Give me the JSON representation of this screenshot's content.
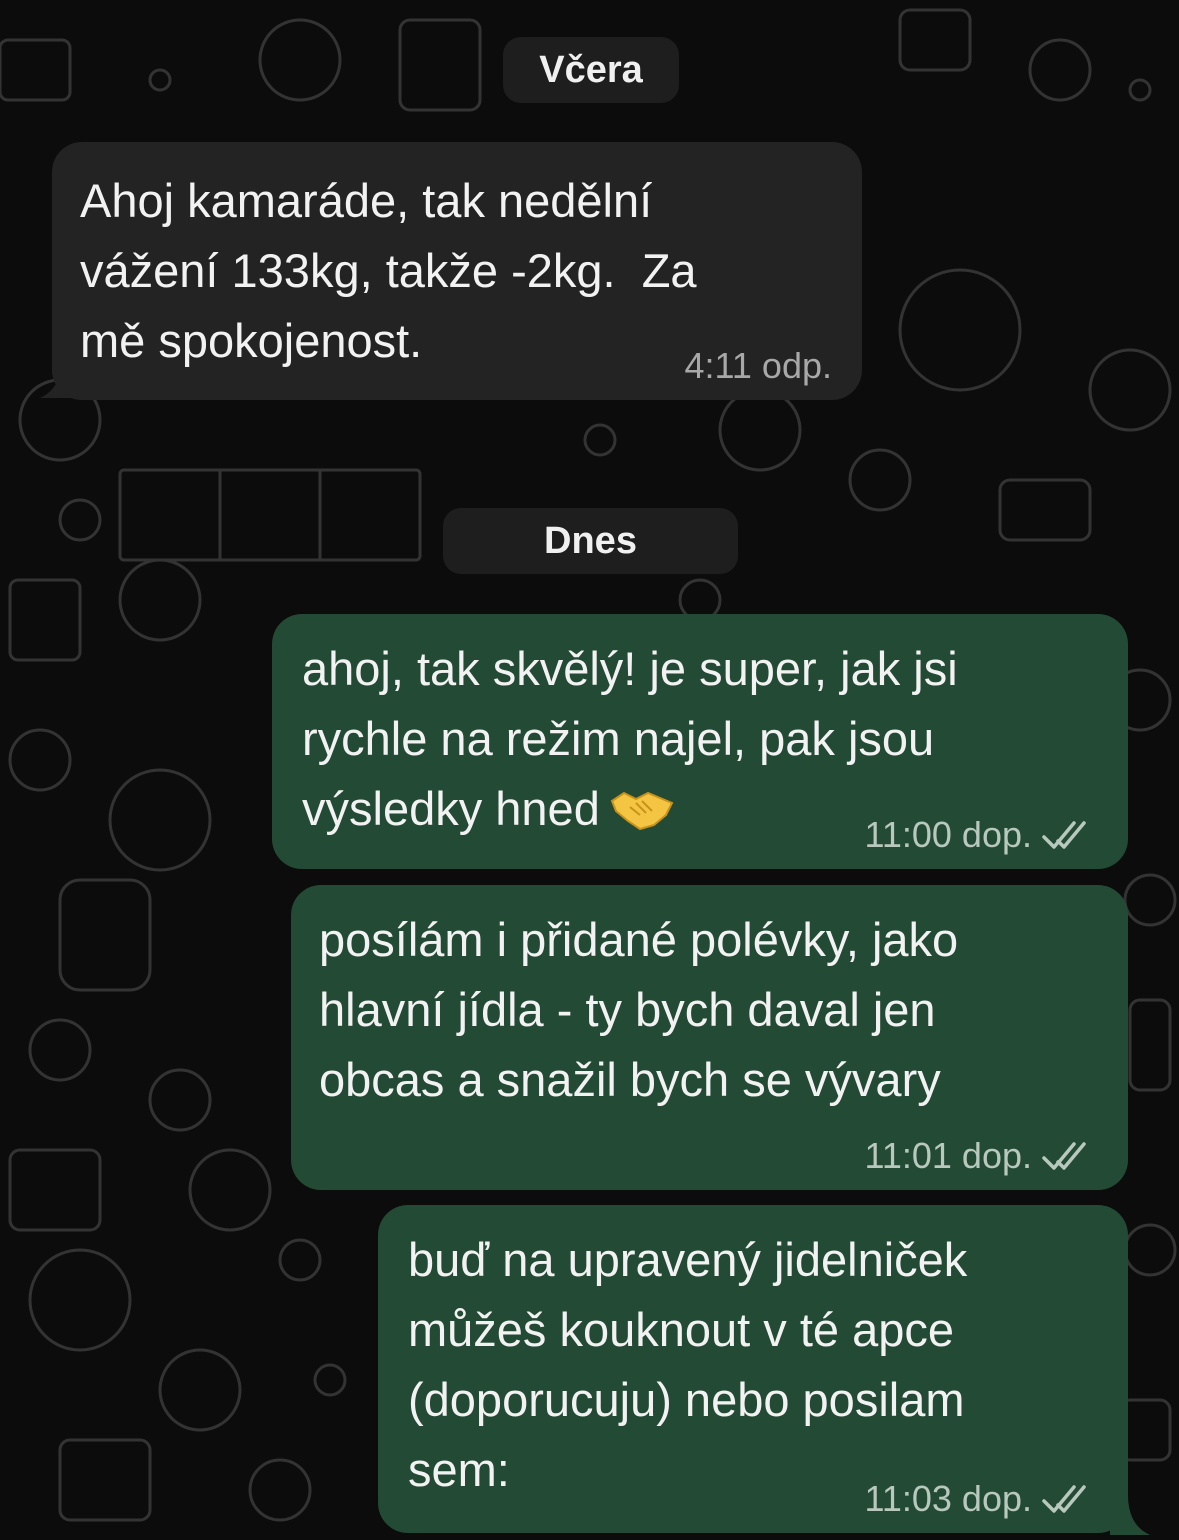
{
  "date_separators": {
    "yesterday": "Včera",
    "today": "Dnes"
  },
  "messages": [
    {
      "direction": "incoming",
      "text": "Ahoj kamaráde, tak nedělní\nvážení 133kg, takže -2kg.  Za\nmě spokojenost.",
      "time": "4:11 odp.",
      "status_icon": ""
    },
    {
      "direction": "outgoing",
      "text": "ahoj, tak skvělý! je super, jak jsi\nrychle na režim najel, pak jsou\nvýsledky hned",
      "emoji": "handshake-emoji",
      "time": "11:00 dop.",
      "status_icon": "double-check-icon"
    },
    {
      "direction": "outgoing",
      "text": "posílám i přidané polévky, jako\nhlavní jídla - ty bych daval jen\nobcas a snažil bych se vývary",
      "time": "11:01 dop.",
      "status_icon": "double-check-icon"
    },
    {
      "direction": "outgoing",
      "text": "buď na upravený jidelniček\nmůžeš kouknout v té apce\n(doporucuju) nebo posilam\nsem:",
      "time": "11:03 dop.",
      "status_icon": "double-check-icon"
    }
  ],
  "colors": {
    "background": "#0c0c0c",
    "incoming_bubble": "#232323",
    "outgoing_bubble": "#234a35",
    "date_pill": "#1e1e1e",
    "timestamp": "#a8a8a8"
  }
}
